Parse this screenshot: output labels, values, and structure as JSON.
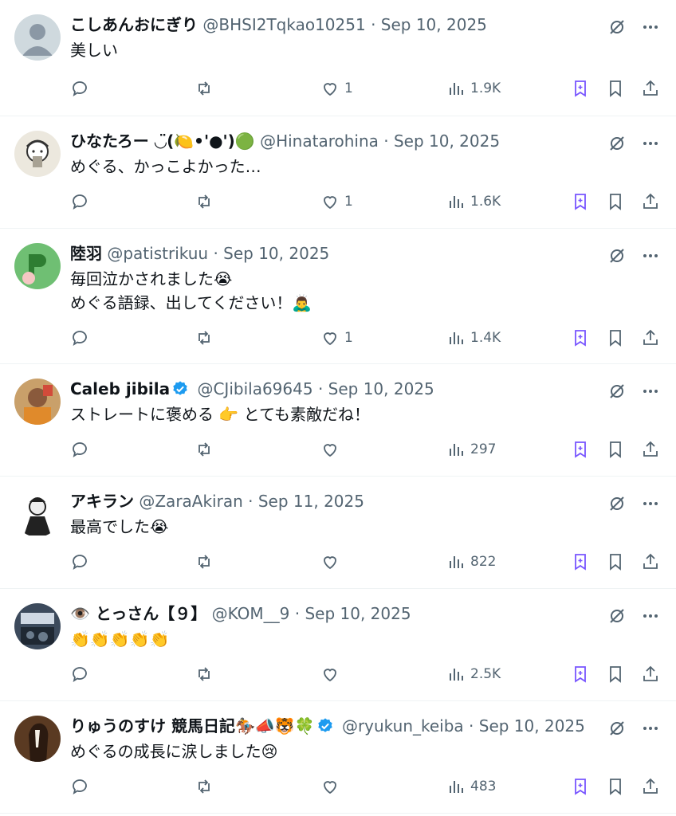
{
  "colors": {
    "text": "#0f1419",
    "muted": "#536471",
    "accent_purple": "#7856ff",
    "verified_blue": "#1d9bf0",
    "divider": "#eff3f4"
  },
  "icons": {
    "reply": "reply-icon",
    "retweet": "retweet-icon",
    "like": "heart-icon",
    "views": "views-icon",
    "grok": "grok-icon",
    "bookmark": "bookmark-icon",
    "share": "share-icon",
    "more": "more-icon",
    "ai": "grok-slash-icon"
  },
  "tweets": [
    {
      "name": "こしあんおにぎり",
      "handle": "@BHSI2Tqkao10251",
      "date": "Sep 10, 2025",
      "text": "美しい",
      "likes": "1",
      "views": "1.9K",
      "verified": false
    },
    {
      "name": "ひなたろー ◡̈(🍋•'●')🟢",
      "handle": "@Hinatarohina",
      "date": "Sep 10, 2025",
      "text": "めぐる、かっこよかった…",
      "likes": "1",
      "views": "1.6K",
      "verified": false
    },
    {
      "name": "陸羽",
      "handle": "@patistrikuu",
      "date": "Sep 10, 2025",
      "text": "毎回泣かされました😭\nめぐる語録、出してください！🙇‍♂️",
      "likes": "1",
      "views": "1.4K",
      "verified": false
    },
    {
      "name": "Caleb jibila",
      "handle": "@CJibila69645",
      "date": "Sep 10, 2025",
      "text": "ストレートに褒める 👉 とても素敵だね！",
      "likes": "",
      "views": "297",
      "verified": true
    },
    {
      "name": "アキラン",
      "handle": "@ZaraAkiran",
      "date": "Sep 11, 2025",
      "text": "最高でした😭",
      "likes": "",
      "views": "822",
      "verified": false
    },
    {
      "name": "👁️ とっさん【９】",
      "handle": "@KOM__9",
      "date": "Sep 10, 2025",
      "text": "👏👏👏👏👏",
      "likes": "",
      "views": "2.5K",
      "verified": false
    },
    {
      "name": "りゅうのすけ 競馬日記🏇📣🐯🍀",
      "handle": "@ryukun_keiba",
      "date": "Sep 10, 2025",
      "text": "めぐるの成長に涙しました😢",
      "likes": "",
      "views": "483",
      "verified": true
    }
  ]
}
